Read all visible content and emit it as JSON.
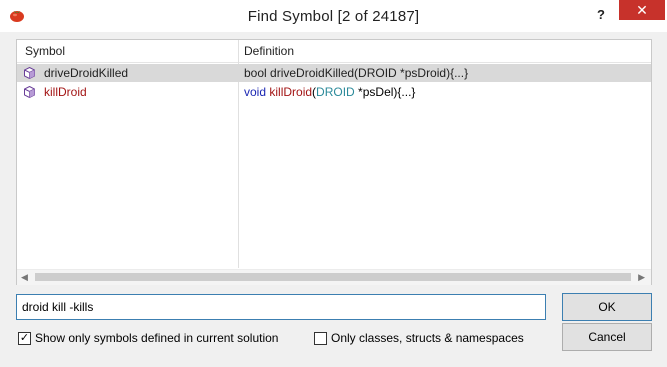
{
  "window": {
    "title": "Find Symbol [2 of 24187]",
    "help_label": "?",
    "close_label": "✕"
  },
  "list": {
    "columns": [
      "Symbol",
      "Definition"
    ],
    "rows": [
      {
        "symbol": "driveDroidKilled",
        "definition": "bool driveDroidKilled(DROID *psDroid){...}",
        "selected": true
      },
      {
        "symbol": "killDroid",
        "def_kw": "void",
        "def_fn": "killDroid",
        "def_paren": "(",
        "def_type": "DROID",
        "def_rest": " *psDel){...}",
        "selected": false
      }
    ]
  },
  "search": {
    "value": "droid kill -kills"
  },
  "buttons": {
    "ok": "OK",
    "cancel": "Cancel"
  },
  "options": {
    "show_only_solution": {
      "label": "Show only symbols defined in current solution",
      "checked": true
    },
    "only_classes": {
      "label": "Only classes, structs & namespaces",
      "checked": false
    }
  },
  "colors": {
    "close_button": "#c7322b",
    "selection": "#d9d9d9",
    "keyword": "#1b27b3",
    "function_name": "#a31515",
    "type_name": "#2b8a9a",
    "focus_border": "#3c7fb1"
  },
  "icons": {
    "app": "tomato-icon",
    "symbol": "function-cube-icon"
  }
}
